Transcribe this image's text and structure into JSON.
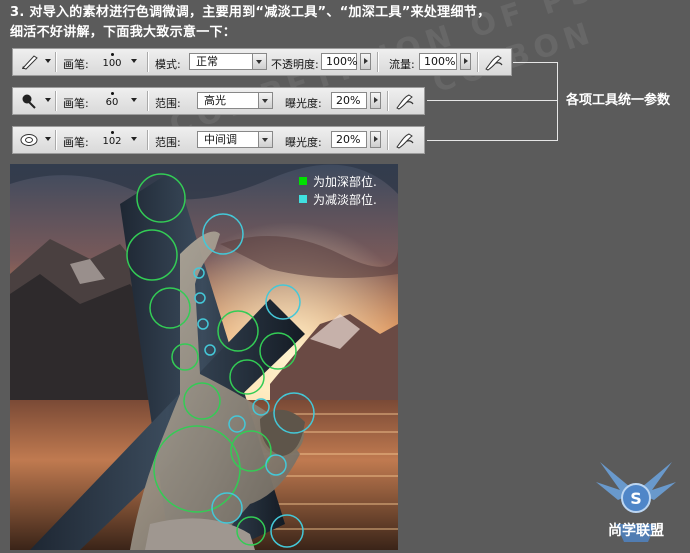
{
  "intro": {
    "line1": "3. 对导入的素材进行色调微调，主要用到“减淡工具”、“加深工具”来处理细节，",
    "line2": "细活不好讲解，下面我大致示意一下："
  },
  "toolbars": [
    {
      "icon": "brush-icon",
      "brush_label": "画笔:",
      "brush_size": "100",
      "mode_label": "模式:",
      "mode_value": "正常",
      "opacity_label": "不透明度:",
      "opacity_value": "100%",
      "flow_label": "流量:",
      "flow_value": "100%"
    },
    {
      "icon": "burn-icon",
      "brush_label": "画笔:",
      "brush_size": "60",
      "range_label": "范围:",
      "range_value": "高光",
      "exposure_label": "曝光度:",
      "exposure_value": "20%"
    },
    {
      "icon": "dodge-icon",
      "brush_label": "画笔:",
      "brush_size": "102",
      "range_label": "范围:",
      "range_value": "中间调",
      "exposure_label": "曝光度:",
      "exposure_value": "20%"
    }
  ],
  "annotation": "各项工具统一参数",
  "legend": {
    "burn": {
      "label": "为加深部位.",
      "color": "#00e000"
    },
    "dodge": {
      "label": "为减淡部位.",
      "color": "#40e0e0"
    }
  },
  "colors": {
    "background": "#5b5b5b",
    "burn_circle": "#33cc55",
    "dodge_circle": "#44c8d8"
  },
  "logo": {
    "text": "尚学联盟",
    "glyph": "S"
  }
}
